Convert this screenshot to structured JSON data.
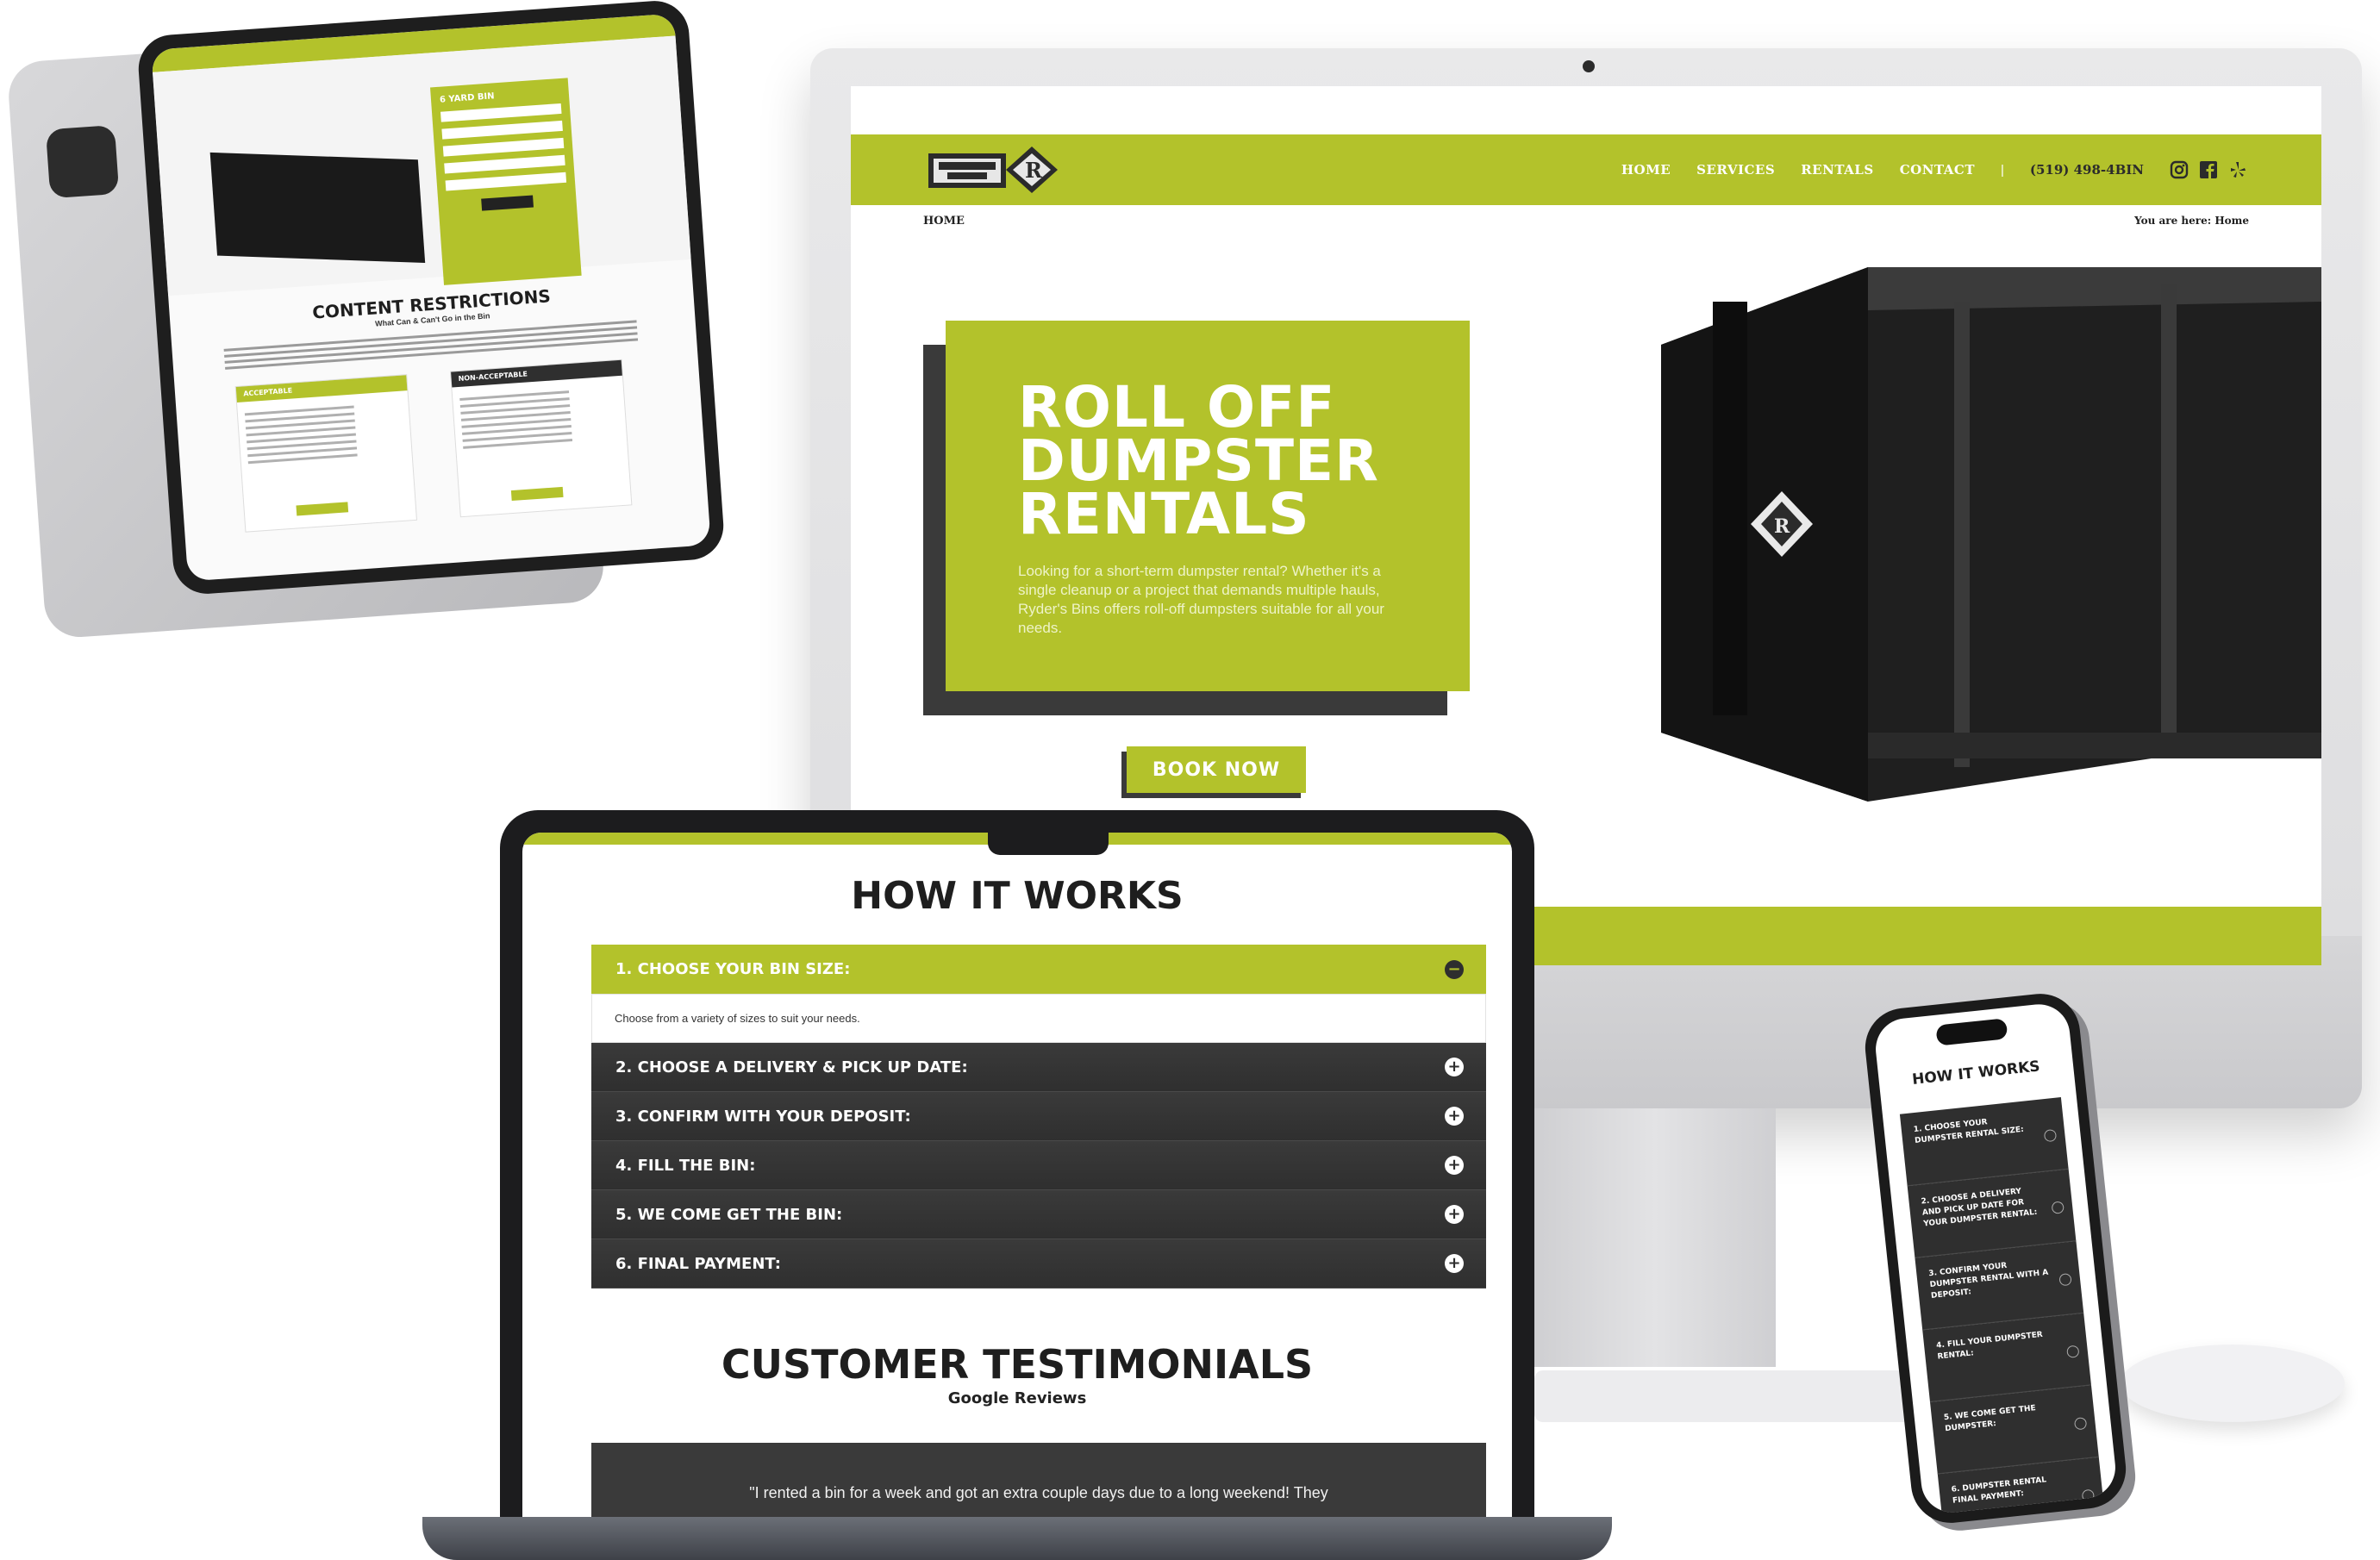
{
  "desktop": {
    "nav": {
      "items": [
        "HOME",
        "SERVICES",
        "RENTALS",
        "CONTACT"
      ],
      "separator": "|",
      "phone": "(519) 498-4BIN",
      "social_icons": [
        "instagram-icon",
        "facebook-icon",
        "yelp-icon"
      ]
    },
    "breadcrumb": "HOME",
    "you_are_here": "You are here: Home",
    "hero": {
      "title": "ROLL OFF DUMPSTER RENTALS",
      "subtitle": "Looking for a short-term dumpster rental? Whether it's a single cleanup or a project that demands multiple hauls, Ryder's Bins offers roll-off dumpsters suitable for all your needs.",
      "button": "BOOK NOW"
    },
    "brand_color": "#b3c22b"
  },
  "tablet": {
    "form_title": "6 YARD BIN",
    "heading": "CONTENT RESTRICTIONS",
    "subheading": "What Can & Can't Go in the Bin",
    "acceptable_label": "ACCEPTABLE",
    "non_acceptable_label": "NON-ACCEPTABLE"
  },
  "laptop": {
    "how_title": "HOW IT WORKS",
    "steps": [
      {
        "label": "1. CHOOSE YOUR BIN SIZE:",
        "icon": "−",
        "active": true
      },
      {
        "label": "2. CHOOSE A DELIVERY & PICK UP DATE:",
        "icon": "+"
      },
      {
        "label": "3. CONFIRM WITH YOUR DEPOSIT:",
        "icon": "+"
      },
      {
        "label": "4. FILL THE BIN:",
        "icon": "+"
      },
      {
        "label": "5. WE COME GET THE BIN:",
        "icon": "+"
      },
      {
        "label": "6. FINAL PAYMENT:",
        "icon": "+"
      }
    ],
    "step1_body": "Choose from a variety of sizes to suit your needs.",
    "testimonials_title": "CUSTOMER TESTIMONIALS",
    "testimonials_sub": "Google Reviews",
    "quote": "\"I rented a bin for a week and got an extra couple days due to a long weekend! They"
  },
  "phone": {
    "title": "HOW IT WORKS",
    "steps": [
      "1. CHOOSE YOUR DUMPSTER RENTAL SIZE:",
      "2. CHOOSE A DELIVERY AND PICK UP DATE FOR YOUR DUMPSTER RENTAL:",
      "3. CONFIRM YOUR DUMPSTER RENTAL WITH A DEPOSIT:",
      "4. FILL YOUR DUMPSTER RENTAL:",
      "5. WE COME GET THE DUMPSTER:",
      "6. DUMPSTER RENTAL FINAL PAYMENT:"
    ]
  }
}
